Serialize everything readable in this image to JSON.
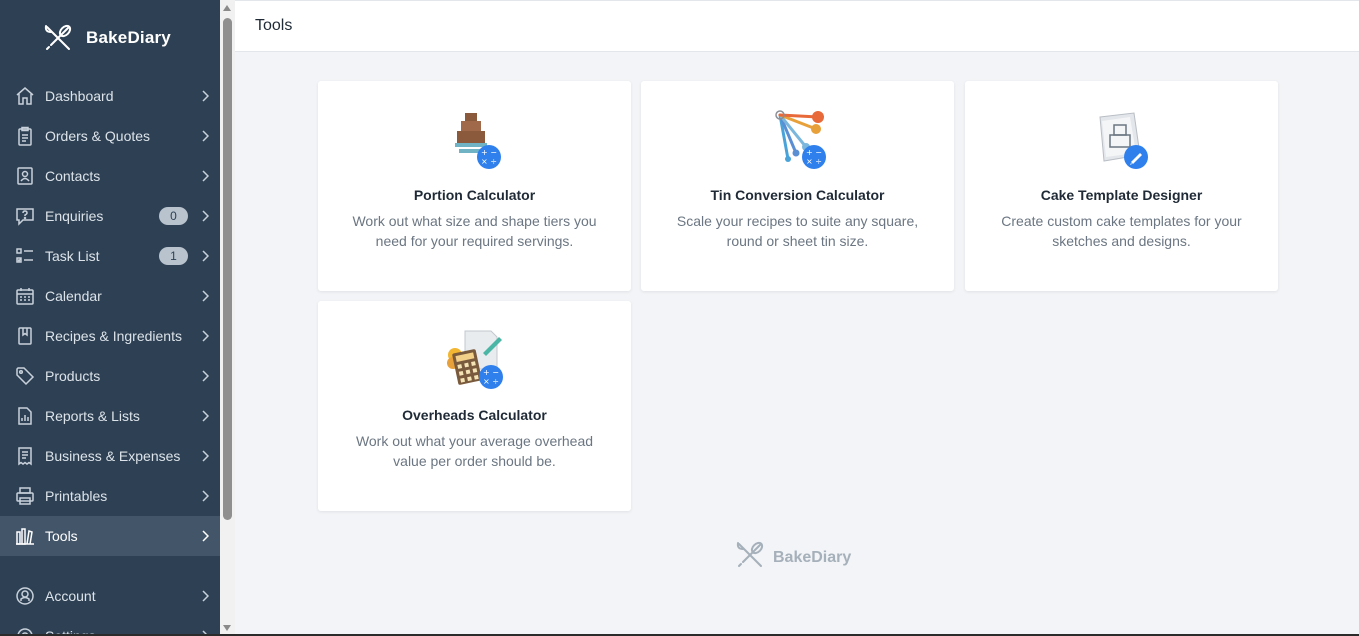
{
  "app": {
    "name": "BakeDiary"
  },
  "sidebar": {
    "items": [
      {
        "label": "Dashboard",
        "icon": "home-icon"
      },
      {
        "label": "Orders & Quotes",
        "icon": "clipboard-icon"
      },
      {
        "label": "Contacts",
        "icon": "contact-card-icon"
      },
      {
        "label": "Enquiries",
        "icon": "question-bubble-icon",
        "badge": "0"
      },
      {
        "label": "Task List",
        "icon": "checklist-icon",
        "badge": "1"
      },
      {
        "label": "Calendar",
        "icon": "calendar-icon"
      },
      {
        "label": "Recipes & Ingredients",
        "icon": "book-icon"
      },
      {
        "label": "Products",
        "icon": "tag-icon"
      },
      {
        "label": "Reports & Lists",
        "icon": "report-icon"
      },
      {
        "label": "Business & Expenses",
        "icon": "receipt-icon"
      },
      {
        "label": "Printables",
        "icon": "printer-icon"
      },
      {
        "label": "Tools",
        "icon": "tools-icon",
        "active": true
      }
    ],
    "bottom_items": [
      {
        "label": "Account",
        "icon": "account-icon"
      },
      {
        "label": "Settings",
        "icon": "gear-icon"
      }
    ]
  },
  "header": {
    "title": "Tools"
  },
  "tools": [
    {
      "title": "Portion Calculator",
      "description": "Work out what size and shape tiers you need for your required servings.",
      "icon": "cake-calculator-icon"
    },
    {
      "title": "Tin Conversion Calculator",
      "description": "Scale your recipes to suite any square, round or sheet tin size.",
      "icon": "measuring-spoons-icon"
    },
    {
      "title": "Cake Template Designer",
      "description": "Create custom cake templates for your sketches and designs.",
      "icon": "cake-template-icon"
    },
    {
      "title": "Overheads Calculator",
      "description": "Work out what your average overhead value per order should be.",
      "icon": "calculator-coins-icon"
    }
  ],
  "footer": {
    "brand": "BakeDiary"
  },
  "colors": {
    "sidebar_bg": "#2e4053",
    "active_bg": "#435568",
    "accent_blue": "#2f80ed",
    "page_bg": "#f2f4f7"
  }
}
